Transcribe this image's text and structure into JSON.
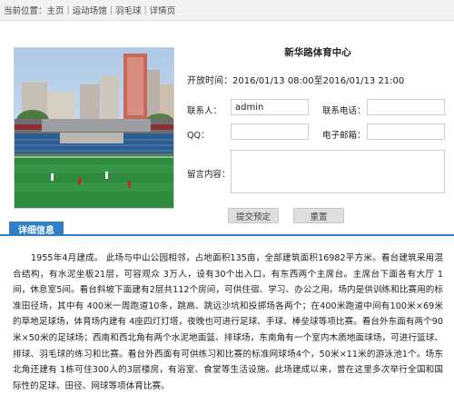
{
  "breadcrumb": {
    "prefix": "当前位置：",
    "items": [
      "主页",
      "运动场馆",
      "羽毛球",
      "详情页"
    ],
    "separator": "|"
  },
  "venue": {
    "name": "新华路体育中心",
    "open_time_label": "开放时间：",
    "open_time_value": "2016/01/13 08:00至2016/01/13 21:00"
  },
  "form": {
    "contact_label": "联系人：",
    "contact_value": "admin",
    "phone_label": "联系电话：",
    "phone_value": "",
    "qq_label": "QQ：",
    "qq_value": "",
    "email_label": "电子邮箱：",
    "email_value": "",
    "message_label": "留言内容：",
    "message_value": ""
  },
  "buttons": {
    "submit": "提交预定",
    "reset": "重置"
  },
  "tabs": {
    "detail": "详细信息"
  },
  "detail_text": "1955年4月建成。 此场与中山公园相邻，占地面积135亩，全部建筑面积16982平方米。看台建筑采用混合结构，有水泥坐板21层，可容观众 3万人，设有30个出入口。有东西两个主席台。主席台下面各有大厅 1间，休息室5间。看台斜坡下面建有2层共112个房间，可供住宿、学习、办公之用。场内是供训练和比赛用的标准田径场，其中有 400米一周跑道10条，跳高、跳远沙坑和投掷场各两个；在400米跑道中间有100米×69米的草地足球场，体育场内建有 4座四灯灯塔，夜晚也可进行足球、手球、棒垒球等项比赛。看台外东面有两个90米×50米的足球场；西南和西北角有两个水泥地面篮、排球场，东南角有一个室内木质地面球场，可进行篮球、排球、羽毛球的练习和比赛。看台外西面有可供练习和比赛的标准网球场4个，50米×11米的游泳池1个。场东北角还建有 1栋可住300人的3层楼房，有浴室、食堂等生活设施。此场建成以来，曾在这里多次举行全国和国际性的足球、田径、网球等项体育比赛。"
}
